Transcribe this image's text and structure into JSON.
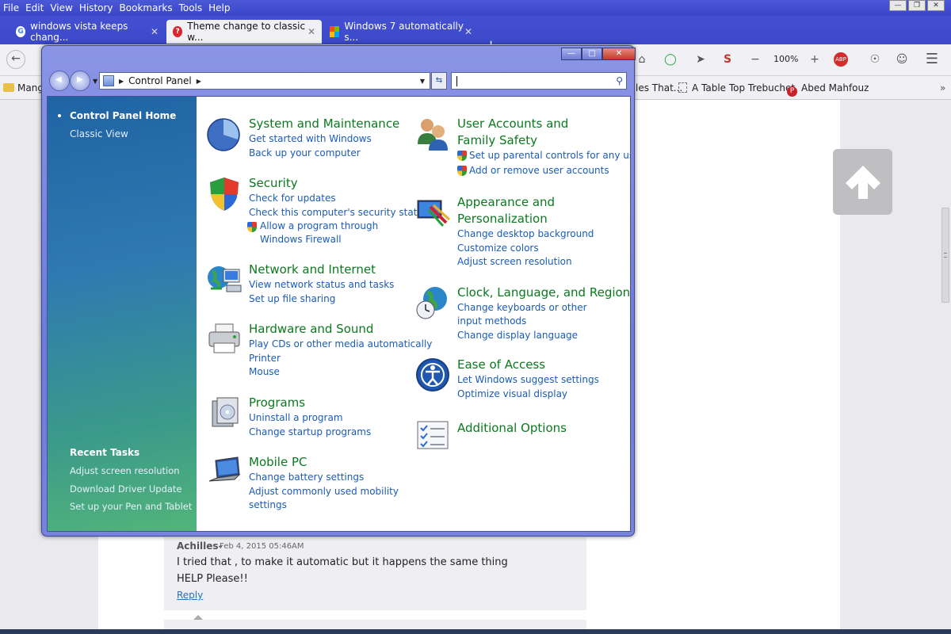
{
  "browser": {
    "menu": [
      "File",
      "Edit",
      "View",
      "History",
      "Bookmarks",
      "Tools",
      "Help"
    ],
    "tabs": [
      {
        "label": "windows vista keeps chang...",
        "icon": "google-icon",
        "active": false
      },
      {
        "label": "Theme change to classic w...",
        "icon": "help-site-icon",
        "active": true
      },
      {
        "label": "Windows 7 automatically s...",
        "icon": "windows-icon",
        "active": false
      }
    ],
    "zoom": "100%",
    "bookmarks": [
      "Mang",
      "les That...",
      "A Table Top Trebuchet",
      "Abed Mahfouz"
    ]
  },
  "page": {
    "comment": {
      "author": "Achilles-",
      "date": "Feb 4, 2015 05:46AM",
      "line1": "I tried that , to make it automatic but it happens the same thing",
      "line2": "HELP Please!!",
      "reply": "Reply"
    }
  },
  "control_panel": {
    "address": "Control Panel",
    "sidebar": {
      "home": "Control Panel Home",
      "classic": "Classic View",
      "recent_heading": "Recent Tasks",
      "recent": [
        "Adjust screen resolution",
        "Download Driver Update",
        "Set up your Pen and Tablet"
      ]
    },
    "categories": {
      "system": {
        "title": "System and Maintenance",
        "links": [
          "Get started with Windows",
          "Back up your computer"
        ]
      },
      "security": {
        "title": "Security",
        "links": [
          "Check for updates",
          "Check this computer's security status",
          "Allow a program through Windows Firewall"
        ]
      },
      "network": {
        "title": "Network and Internet",
        "links": [
          "View network status and tasks",
          "Set up file sharing"
        ]
      },
      "hardware": {
        "title": "Hardware and Sound",
        "links": [
          "Play CDs or other media automatically",
          "Printer",
          "Mouse"
        ]
      },
      "programs": {
        "title": "Programs",
        "links": [
          "Uninstall a program",
          "Change startup programs"
        ]
      },
      "mobile": {
        "title": "Mobile PC",
        "links": [
          "Change battery settings",
          "Adjust commonly used mobility settings"
        ]
      },
      "users": {
        "title": "User Accounts and Family Safety",
        "links": [
          "Set up parental controls for any user",
          "Add or remove user accounts"
        ]
      },
      "appearance": {
        "title": "Appearance and Personalization",
        "links": [
          "Change desktop background",
          "Customize colors",
          "Adjust screen resolution"
        ]
      },
      "clock": {
        "title": "Clock, Language, and Region",
        "links": [
          "Change keyboards or other input methods",
          "Change display language"
        ]
      },
      "ease": {
        "title": "Ease of Access",
        "links": [
          "Let Windows suggest settings",
          "Optimize visual display"
        ]
      },
      "additional": {
        "title": "Additional Options"
      }
    }
  }
}
